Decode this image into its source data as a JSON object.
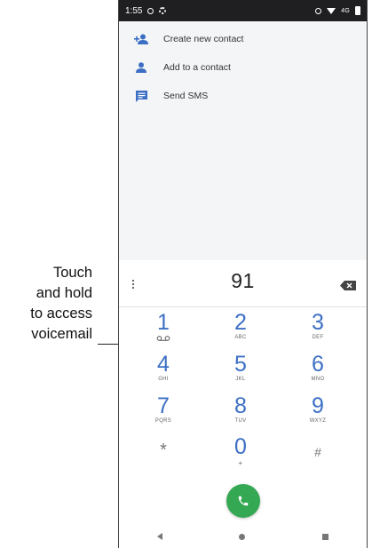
{
  "callout": {
    "line1": "Touch",
    "line2": "and hold",
    "line3": "to access",
    "line4": "voicemail"
  },
  "status_bar": {
    "time": "1:55",
    "network": "4G"
  },
  "actions": [
    {
      "label": "Create new contact",
      "icon": "add-person-icon"
    },
    {
      "label": "Add to a contact",
      "icon": "person-icon"
    },
    {
      "label": "Send SMS",
      "icon": "message-icon"
    }
  ],
  "dialpad": {
    "number": "91",
    "keys": [
      {
        "digit": "1",
        "letters": ""
      },
      {
        "digit": "2",
        "letters": "ABC"
      },
      {
        "digit": "3",
        "letters": "DEF"
      },
      {
        "digit": "4",
        "letters": "GHI"
      },
      {
        "digit": "5",
        "letters": "JKL"
      },
      {
        "digit": "6",
        "letters": "MNO"
      },
      {
        "digit": "7",
        "letters": "PQRS"
      },
      {
        "digit": "8",
        "letters": "TUV"
      },
      {
        "digit": "9",
        "letters": "WXYZ"
      },
      {
        "digit": "*",
        "letters": ""
      },
      {
        "digit": "0",
        "letters": "+"
      },
      {
        "digit": "#",
        "letters": ""
      }
    ]
  },
  "colors": {
    "accent_blue": "#3c6fc4",
    "call_green": "#35a853",
    "status_bar": "#1f1f22"
  }
}
